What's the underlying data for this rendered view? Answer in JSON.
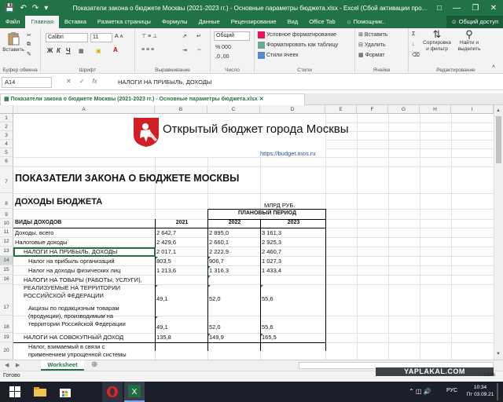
{
  "window": {
    "title": "Показатели закона о бюджете Москвы (2021-2023 гг.) - Основные параметры бюджета.xlsx - Excel (Сбой активации про..."
  },
  "ribbon_tabs": [
    "Файл",
    "Главная",
    "Вставка",
    "Разметка страницы",
    "Формулы",
    "Данные",
    "Рецензирование",
    "Вид",
    "Office Tab"
  ],
  "tell_me": "Помощник..",
  "share": "Общий доступ",
  "groups": {
    "clipboard": "Буфер обмена",
    "font": "Шрифт",
    "align": "Выравнивание",
    "number": "Число",
    "styles": "Стили",
    "cells": "Ячейки",
    "editing": "Редактирование"
  },
  "buttons": {
    "paste": "Вставить",
    "cond_format": "Условное форматирование",
    "format_table": "Форматировать как таблицу",
    "cell_styles": "Стили ячеек",
    "insert": "Вставить",
    "delete": "Удалить",
    "format": "Формат",
    "sort": "Сортировка и фильтр",
    "find": "Найти и выделить"
  },
  "font": {
    "name": "Calibri",
    "size": "11"
  },
  "number_format": "Общий",
  "formula_bar": {
    "namebox": "A14",
    "fx": "fx",
    "content": "НАЛОГИ НА ПРИБЫЛЬ, ДОХОДЫ"
  },
  "doc_tab": "Показатели закона о бюджете Москвы (2021-2023 гг.) - Основные параметры бюджета.xlsx",
  "columns": [
    "A",
    "B",
    "C",
    "D",
    "E",
    "F",
    "G",
    "H",
    "I"
  ],
  "rows": [
    "1",
    "2",
    "3",
    "4",
    "5",
    "6",
    "7",
    "8",
    "9",
    "10",
    "11",
    "12",
    "13",
    "14",
    "15",
    "16",
    "17",
    "18",
    "19",
    "20"
  ],
  "sheet": {
    "logo_text": "Открытый бюджет города Москвы",
    "url": "https://budget.mos.ru",
    "heading": "ПОКАЗАТЕЛИ ЗАКОНА О БЮДЖЕТЕ МОСКВЫ",
    "subheading": "ДОХОДЫ БЮДЖЕТА",
    "unit": "МЛРД РУБ.",
    "planned": "ПЛАНОВЫЙ ПЕРИОД",
    "col_type": "ВИДЫ ДОХОДОВ",
    "years": [
      "2021",
      "2022",
      "2023"
    ]
  },
  "table": [
    {
      "label": "Доходы, всего",
      "v": [
        "2 642,7",
        "2 895,0",
        "3 161,3"
      ]
    },
    {
      "label": "Налоговые доходы",
      "v": [
        "2 429,6",
        "2 660,1",
        "2 925,3"
      ]
    },
    {
      "label": "НАЛОГИ НА ПРИБЫЛЬ, ДОХОДЫ",
      "v": [
        "2 017,1",
        "2 222,9",
        "2 460,7"
      ]
    },
    {
      "label": "Налог на прибыль организаций",
      "v": [
        "803,5",
        "906,7",
        "1 027,3"
      ]
    },
    {
      "label": "Налог на доходы физических лиц",
      "v": [
        "1 213,6",
        "1 316,3",
        "1 433,4"
      ]
    },
    {
      "lines": [
        "НАЛОГИ НА ТОВАРЫ (РАБОТЫ, УСЛУГИ),",
        "РЕАЛИЗУЕМЫЕ НА ТЕРРИТОРИИ",
        "РОССИЙСКОЙ ФЕДЕРАЦИИ"
      ],
      "v": [
        "49,1",
        "52,0",
        "55,6"
      ]
    },
    {
      "lines": [
        "Акцизы по подакцизным товарам",
        "(продукции), производимым на",
        "территории Российской Федерации"
      ],
      "v": [
        "49,1",
        "52,0",
        "55,6"
      ]
    },
    {
      "label": "НАЛОГИ НА СОВОКУПНЫЙ ДОХОД",
      "v": [
        "135,8",
        "149,9",
        "165,5"
      ]
    },
    {
      "lines": [
        "Налог, взимаемый в связи с",
        "применением упрощенной системы"
      ]
    }
  ],
  "sheet_tab": "Worksheet",
  "status": {
    "ready": "Готово",
    "zoom": "100%",
    "watermark": "YAPLAKAL.COM"
  },
  "taskbar": {
    "lang": "РУС",
    "time": "10:34",
    "date": "Пт 03.09.21"
  }
}
